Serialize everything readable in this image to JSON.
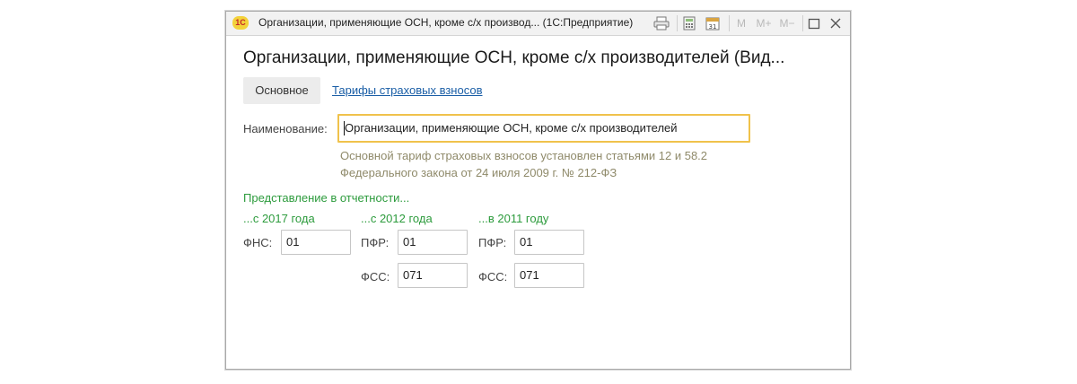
{
  "window": {
    "app_icon_text": "1С",
    "title": "Организации, применяющие ОСН, кроме с/х производ...   (1С:Предприятие)",
    "toolbar": {
      "m": "M",
      "m_plus": "M+",
      "m_minus": "M−",
      "calendar_day": "31"
    }
  },
  "form": {
    "title": "Организации, применяющие ОСН, кроме с/х производителей (Вид...",
    "tabs": {
      "main": "Основное",
      "tariffs": "Тарифы страховых взносов"
    },
    "name_label": "Наименование:",
    "name_value": "Организации, применяющие ОСН, кроме с/х производителей",
    "hint": "Основной тариф страховых взносов установлен статьями 12 и 58.2 Федерального закона от 24 июля 2009 г. № 212-ФЗ",
    "reporting": {
      "heading": "Представление в отчетности...",
      "col_2017": {
        "title": "...с 2017 года",
        "fns_label": "ФНС:",
        "fns_value": "01"
      },
      "col_2012": {
        "title": "...с 2012 года",
        "pfr_label": "ПФР:",
        "pfr_value": "01",
        "fss_label": "ФСС:",
        "fss_value": "071"
      },
      "col_2011": {
        "title": "...в 2011 году",
        "pfr_label": "ПФР:",
        "pfr_value": "01",
        "fss_label": "ФСС:",
        "fss_value": "071"
      }
    }
  },
  "colors": {
    "accent_green": "#2c9b3c",
    "link_blue": "#1a5ea6",
    "focus_yellow": "#f0c24b",
    "hint_text": "#8f8a6a"
  }
}
